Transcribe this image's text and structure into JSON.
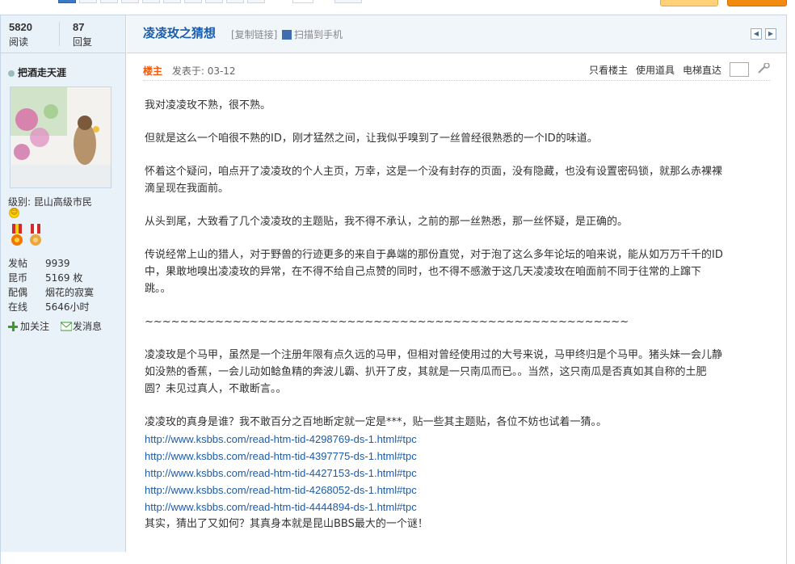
{
  "stats": {
    "views_num": "5820",
    "views_label": "阅读",
    "replies_num": "87",
    "replies_label": "回复"
  },
  "thread": {
    "title": "凌凌玫之猜想",
    "copy_link": "[复制链接]",
    "scan_mobile": "扫描到手机"
  },
  "user": {
    "name": "把酒走天涯",
    "level": "级别: 昆山高级市民",
    "info": [
      {
        "k": "发帖",
        "v": "9939"
      },
      {
        "k": "昆币",
        "v": "5169 枚"
      },
      {
        "k": "配偶",
        "v": "烟花的寂寞"
      },
      {
        "k": "在线",
        "v": "5646小时"
      }
    ],
    "follow": "加关注",
    "message": "发消息"
  },
  "post": {
    "floor": "楼主",
    "date": "发表于: 03-12",
    "tool_only_author": "只看楼主",
    "tool_use": "使用道具",
    "tool_jump": "电梯直达"
  },
  "content": {
    "p1": "我对凌凌玫不熟，很不熟。",
    "p2": "但就是这么一个咱很不熟的ID，刚才猛然之间，让我似乎嗅到了一丝曾经很熟悉的一个ID的味道。",
    "p3a": "怀着这个疑问，咱点开了凌凌玫的个人主页，万幸，这是一个没有封存的页面，没有隐藏，也没有设置密码锁，就那么赤裸裸",
    "p3b": "滴呈现在我面前。",
    "p4": "从头到尾，大致看了几个凌凌玫的主题贴，我不得不承认，之前的那一丝熟悉，那一丝怀疑，是正确的。",
    "p5a": "传说经常上山的猎人，对于野兽的行迹更多的来自于鼻端的那份直觉，对于泡了这么多年论坛的咱来说，能从如万万千千的ID",
    "p5b": "中，果敢地嗅出凌凌玫的异常，在不得不给自己点赞的同时，也不得不感激于这几天凌凌玫在咱面前不同于往常的上蹿下",
    "p5c": "跳。。",
    "tilde": "~~~~~~~~~~~~~~~~~~~~~~~~~~~~~~~~~~~~~~~~~~~~~~~~~~~~~~~",
    "p6a": "凌凌玫是个马甲，虽然是一个注册年限有点久远的马甲，但相对曾经使用过的大号来说，马甲终归是个马甲。猪头妹一会儿静",
    "p6b": "如没熟的香蕉，一会儿动如鲶鱼精的奔波儿霸、扒开了皮，其就是一只南瓜而已。。当然，这只南瓜是否真如其自称的土肥",
    "p6c": "圆？未见过真人，不敢断言。。",
    "p7": "凌凌玫的真身是谁？我不敢百分之百地断定就一定是***，贴一些其主题贴，各位不妨也试着一猜。。",
    "links": [
      "http://www.ksbbs.com/read-htm-tid-4298769-ds-1.html#tpc",
      "http://www.ksbbs.com/read-htm-tid-4397775-ds-1.html#tpc",
      "http://www.ksbbs.com/read-htm-tid-4427153-ds-1.html#tpc",
      "http://www.ksbbs.com/read-htm-tid-4268052-ds-1.html#tpc",
      "http://www.ksbbs.com/read-htm-tid-4444894-ds-1.html#tpc"
    ],
    "p8": "其实，猜出了又如何？其真身本就是昆山BBS最大的一个谜！"
  }
}
